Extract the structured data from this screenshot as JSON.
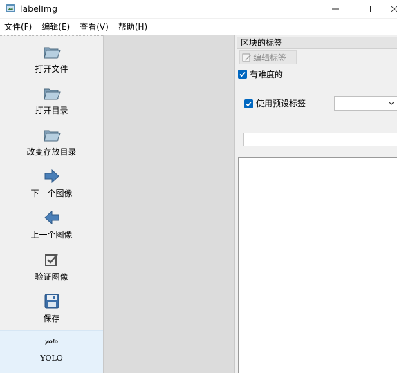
{
  "window": {
    "title": "labelImg"
  },
  "menu": [
    "文件(F)",
    "编辑(E)",
    "查看(V)",
    "帮助(H)"
  ],
  "toolbar": {
    "open_file": "打开文件",
    "open_dir": "打开目录",
    "change_save_dir": "改变存放目录",
    "next_image": "下一个图像",
    "prev_image": "上一个图像",
    "verify_image": "验证图像",
    "save": "保存",
    "format_icon_text": "yolo",
    "format": "YOLO"
  },
  "dock": {
    "title": "区块的标签",
    "edit_label": "编辑标签",
    "difficult_label": "有难度的",
    "difficult_checked": true,
    "use_default_label": "使用预设标签",
    "use_default_checked": true,
    "default_label_value": "",
    "label_text_value": ""
  },
  "colors": {
    "accent": "#0067c0",
    "canvas_bg": "#dcdcdc",
    "active_tool_bg": "#e5f1fb"
  }
}
